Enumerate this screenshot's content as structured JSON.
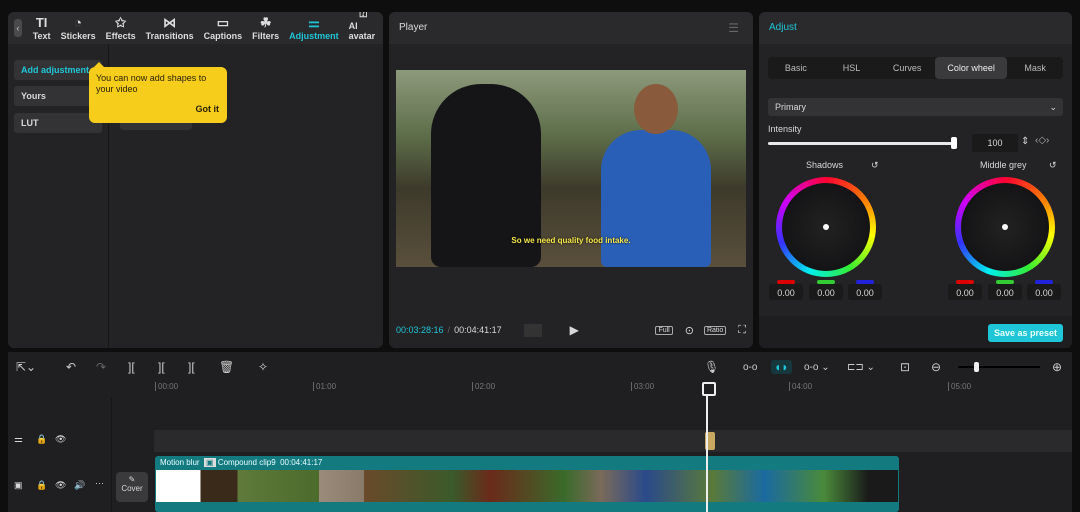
{
  "toolbar": {
    "tabs": [
      {
        "label": "Text",
        "icon": "TI"
      },
      {
        "label": "Stickers",
        "icon": "◔"
      },
      {
        "label": "Effects",
        "icon": "✩"
      },
      {
        "label": "Transitions",
        "icon": "⋈"
      },
      {
        "label": "Captions",
        "icon": "▭"
      },
      {
        "label": "Filters",
        "icon": "☘"
      },
      {
        "label": "Adjustment",
        "icon": "⚌"
      },
      {
        "label": "AI avatar",
        "icon": "⍰"
      }
    ],
    "active": "Adjustment"
  },
  "left": {
    "categories": [
      "Add adjustment",
      "Yours",
      "LUT"
    ]
  },
  "tooltip": {
    "text": "You can now add shapes to your video",
    "action": "Got it"
  },
  "player": {
    "title": "Player",
    "subtitle": "So we need quality food intake.",
    "current_time": "00:03:28:16",
    "total_time": "00:04:41:17",
    "buttons": [
      "Full",
      "Ratio"
    ]
  },
  "adjust": {
    "title": "Adjust",
    "tabs": [
      "Basic",
      "HSL",
      "Curves",
      "Color wheel",
      "Mask"
    ],
    "active_tab": "Color wheel",
    "mode": "Primary",
    "intensity_label": "Intensity",
    "intensity": 100,
    "wheels": [
      {
        "label": "Shadows",
        "r": "0.00",
        "g": "0.00",
        "b": "0.00"
      },
      {
        "label": "Middle grey",
        "r": "0.00",
        "g": "0.00",
        "b": "0.00"
      }
    ],
    "save_label": "Save as preset"
  },
  "timeline": {
    "ruler": [
      "00:00",
      "01:00",
      "02:00",
      "03:00",
      "04:00",
      "05:00"
    ],
    "clip": {
      "effect": "Motion blur",
      "name": "Compound clip9",
      "duration": "00:04:41:17"
    },
    "cover_label": "Cover"
  },
  "colors": {
    "accent": "#1fc6d8",
    "tooltip": "#f6cd1a",
    "clip": "#137a80"
  }
}
